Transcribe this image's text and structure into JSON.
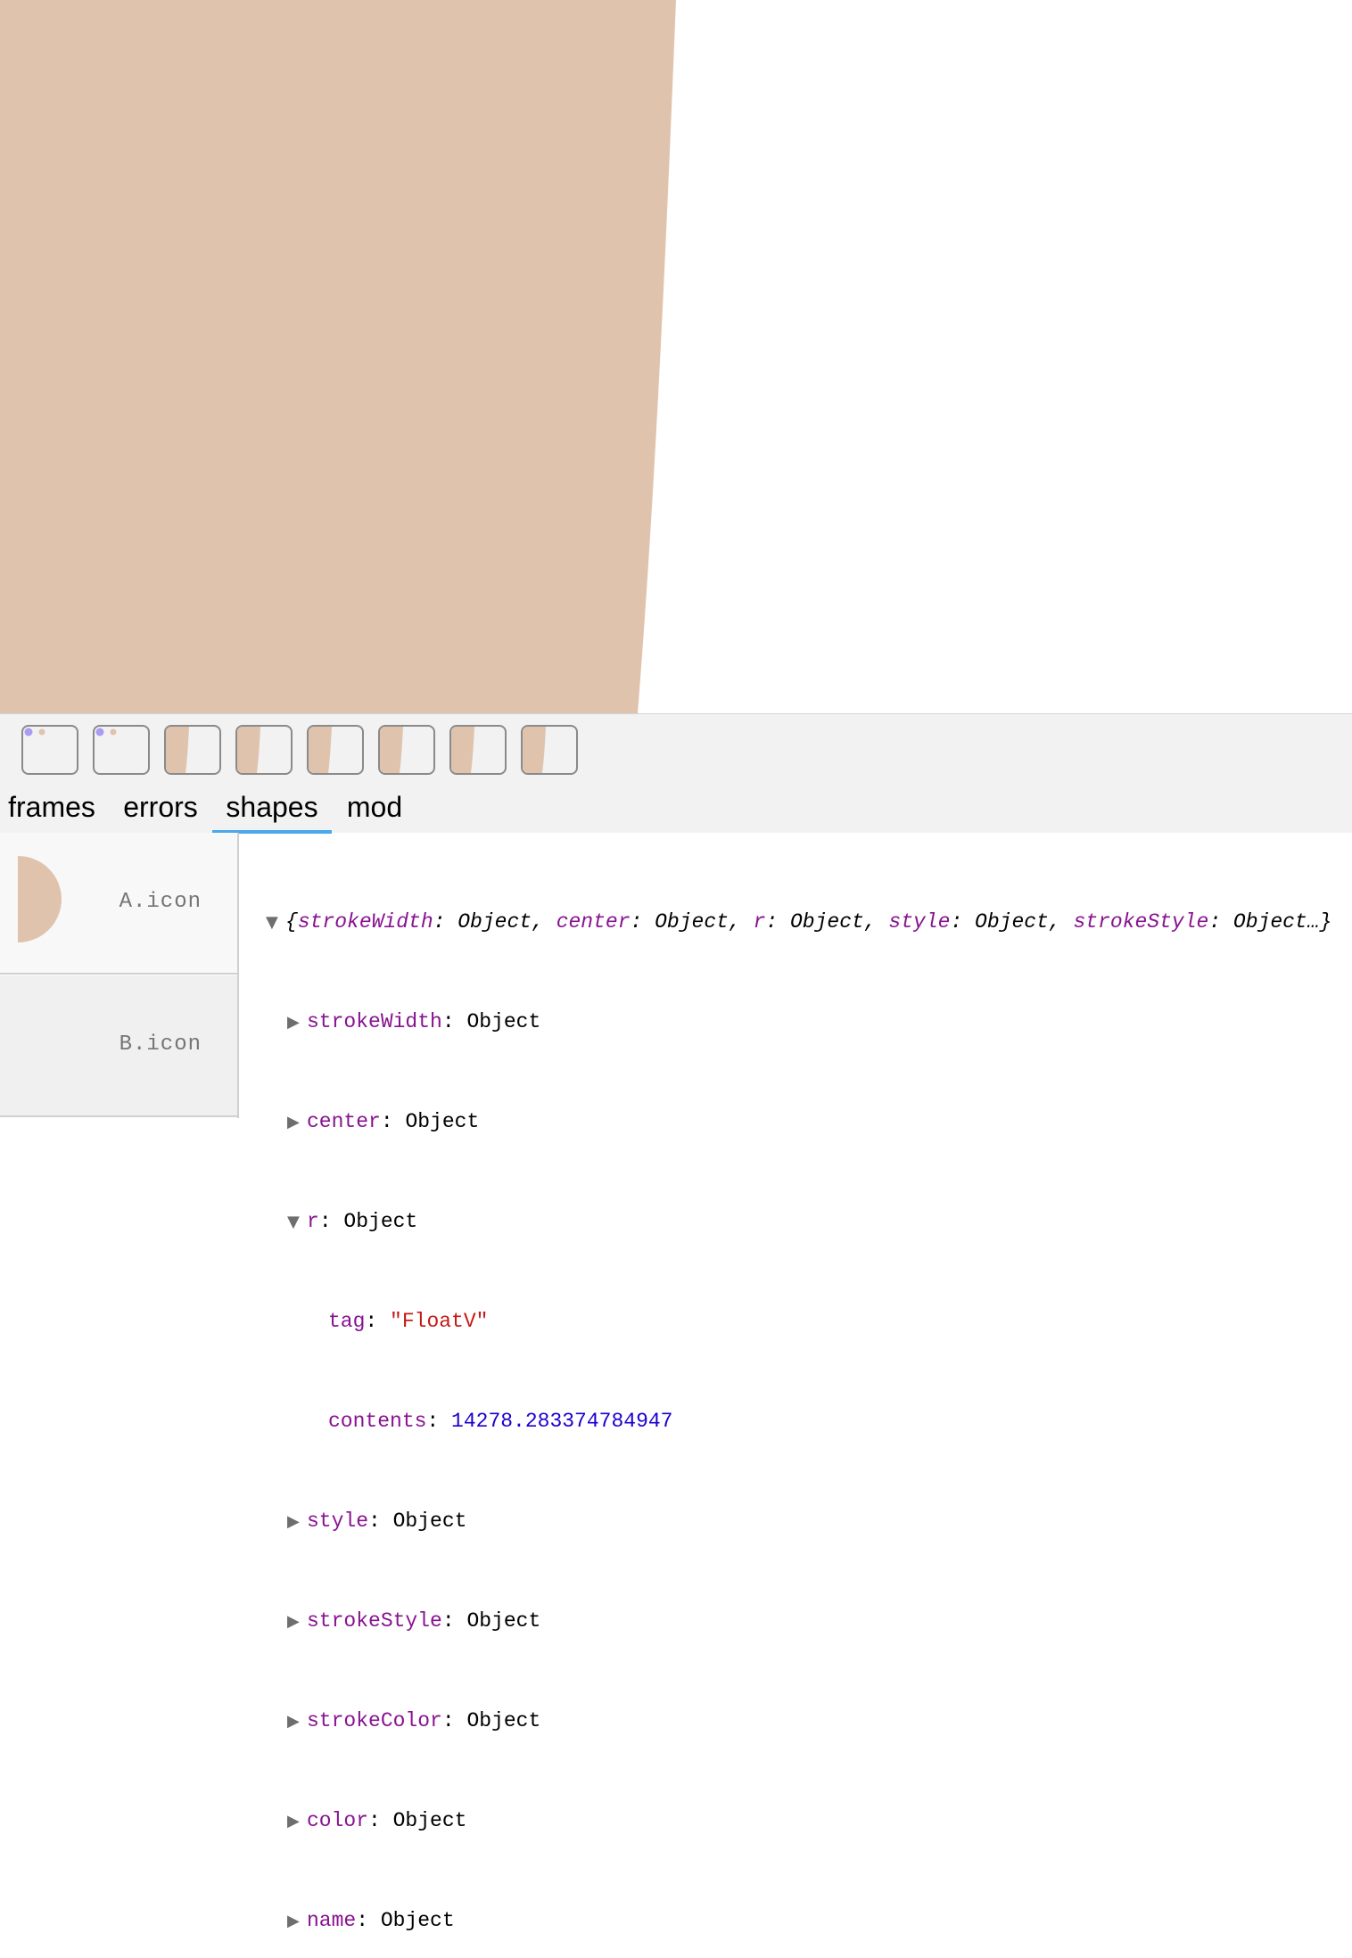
{
  "colors": {
    "shape_fill": "#e0c3ad",
    "dot_purple": "#a99cf2",
    "tab_underline": "#4aa8ec",
    "key": "#881391",
    "string": "#c41a16",
    "number": "#1c00cf"
  },
  "thumbnails": [
    {
      "kind": "dots"
    },
    {
      "kind": "dots"
    },
    {
      "kind": "slice"
    },
    {
      "kind": "slice"
    },
    {
      "kind": "slice"
    },
    {
      "kind": "slice"
    },
    {
      "kind": "slice"
    },
    {
      "kind": "slice"
    }
  ],
  "tabs": {
    "frames": "frames",
    "errors": "errors",
    "shapes": "shapes",
    "mod": "mod",
    "active": "shapes"
  },
  "shapes": {
    "a_label": "A.icon",
    "b_label": "B.icon"
  },
  "inspector": {
    "summary": {
      "open": "{",
      "close": "…}",
      "pairs": [
        {
          "key": "strokeWidth",
          "value": "Object"
        },
        {
          "key": "center",
          "value": "Object"
        },
        {
          "key": "r",
          "value": "Object"
        },
        {
          "key": "style",
          "value": "Object"
        },
        {
          "key": "strokeStyle",
          "value": "Object"
        }
      ]
    },
    "rows": {
      "strokeWidth": {
        "key": "strokeWidth",
        "value": "Object"
      },
      "center": {
        "key": "center",
        "value": "Object"
      },
      "r": {
        "key": "r",
        "value": "Object",
        "tag_key": "tag",
        "tag_value": "\"FloatV\"",
        "contents_key": "contents",
        "contents_value": "14278.283374784947"
      },
      "style": {
        "key": "style",
        "value": "Object"
      },
      "strokeStyle": {
        "key": "strokeStyle",
        "value": "Object"
      },
      "strokeColor": {
        "key": "strokeColor",
        "value": "Object"
      },
      "color": {
        "key": "color",
        "value": "Object"
      },
      "name": {
        "key": "name",
        "value": "Object"
      }
    }
  }
}
